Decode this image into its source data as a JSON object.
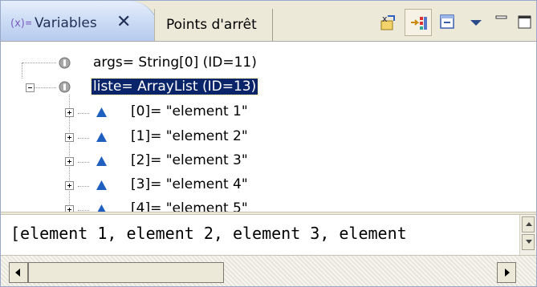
{
  "tabs": [
    {
      "label": "Variables",
      "active": true,
      "icon": "variables-icon"
    },
    {
      "label": "Points d'arrêt",
      "active": false
    }
  ],
  "toolbar": {
    "buttons": [
      {
        "icon": "show-type-names-icon",
        "pressed": false
      },
      {
        "icon": "show-logical-structure-icon",
        "pressed": true
      },
      {
        "icon": "collapse-all-icon",
        "pressed": false
      },
      {
        "icon": "view-menu-icon",
        "pressed": false
      },
      {
        "icon": "minimize-icon",
        "pressed": false
      },
      {
        "icon": "maximize-icon",
        "pressed": false
      }
    ]
  },
  "tree": {
    "nodes": [
      {
        "label": "args= String[0]  (ID=11)",
        "icon": "local-variable-icon",
        "expandable": false,
        "selected": false
      },
      {
        "label": "liste= ArrayList  (ID=13)",
        "icon": "local-variable-icon",
        "expandable": true,
        "expanded": true,
        "selected": true
      },
      {
        "label": "[0]= \"element 1\"",
        "icon": "array-element-icon",
        "expandable": true,
        "expanded": false
      },
      {
        "label": "[1]= \"element 2\"",
        "icon": "array-element-icon",
        "expandable": true,
        "expanded": false
      },
      {
        "label": "[2]= \"element 3\"",
        "icon": "array-element-icon",
        "expandable": true,
        "expanded": false
      },
      {
        "label": "[3]= \"element 4\"",
        "icon": "array-element-icon",
        "expandable": true,
        "expanded": false
      },
      {
        "label": "[4]= \"element 5\"",
        "icon": "array-element-icon",
        "expandable": true,
        "expanded": false
      }
    ]
  },
  "detail": {
    "value": "[element 1, element 2, element 3, element"
  },
  "colors": {
    "selection": "#0a246a",
    "tab_active": "#c9daf4",
    "chrome": "#ece9d8",
    "element_icon": "#1f5fbf"
  }
}
